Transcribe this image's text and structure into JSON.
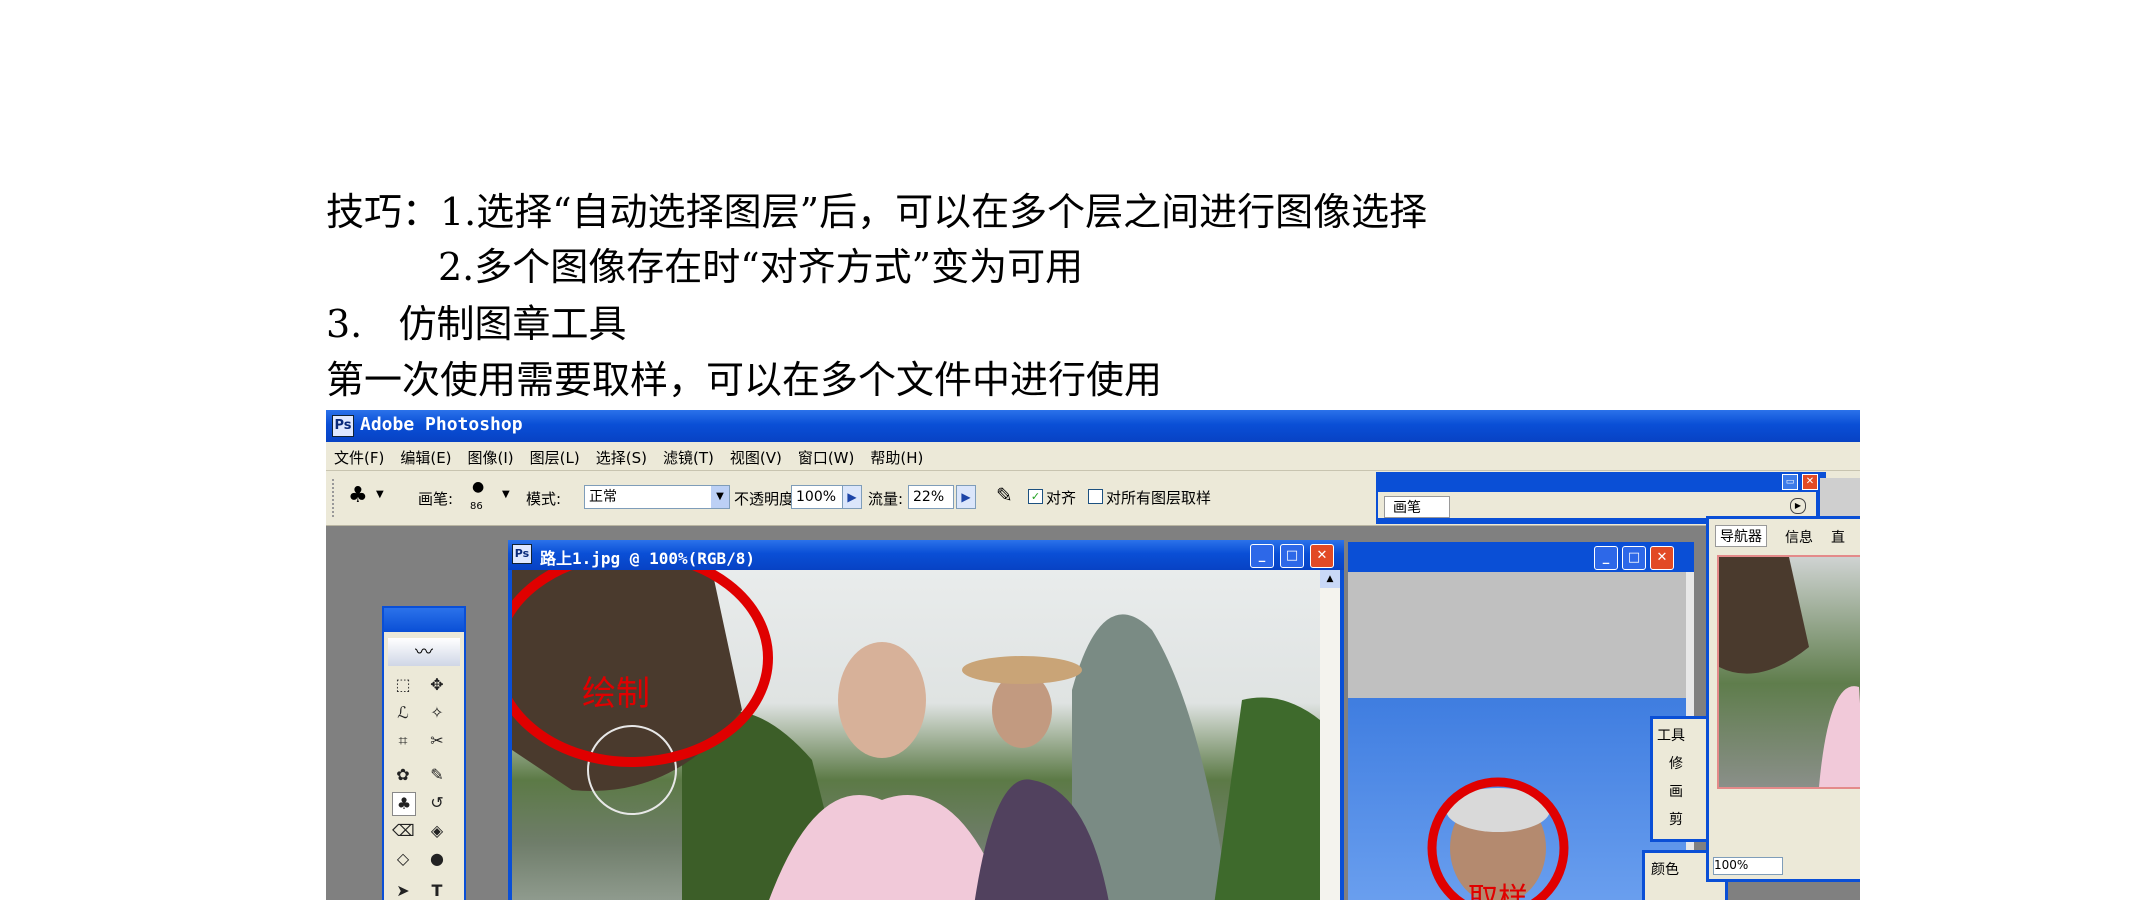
{
  "document": {
    "lines": [
      "技巧：1.选择“自动选择图层”后，可以在多个层之间进行图像选择",
      "2.多个图像存在时“对齐方式”变为可用",
      "3.   仿制图章工具",
      "第一次使用需要取样，可以在多个文件中进行使用"
    ]
  },
  "app": {
    "title": "Adobe Photoshop",
    "menu": [
      "文件(F)",
      "编辑(E)",
      "图像(I)",
      "图层(L)",
      "选择(S)",
      "滤镜(T)",
      "视图(V)",
      "窗口(W)",
      "帮助(H)"
    ]
  },
  "options": {
    "brush_label": "画笔:",
    "brush_size": "86",
    "mode_label": "模式:",
    "mode_value": "正常",
    "opacity_label": "不透明度:",
    "opacity_value": "100%",
    "flow_label": "流量:",
    "flow_value": "22%",
    "align_label": "对齐",
    "all_layers_label": "对所有图层取样"
  },
  "brush_palette": {
    "title": "画笔"
  },
  "image_window": {
    "title": "路上1.jpg @ 100%(RGB/8)"
  },
  "annotations": {
    "draw": "绘制",
    "sample": "取样"
  },
  "navigator": {
    "tabs": [
      "导航器",
      "信息",
      "直"
    ],
    "zoom": "100%"
  },
  "tool_panel": {
    "title": "工具",
    "items": [
      "修",
      "画",
      "剪"
    ]
  },
  "color_panel": {
    "title": "颜色"
  },
  "colors": {
    "xp_blue": "#0a4fd6",
    "annotation_red": "#e00000",
    "chrome": "#ece9d8"
  }
}
